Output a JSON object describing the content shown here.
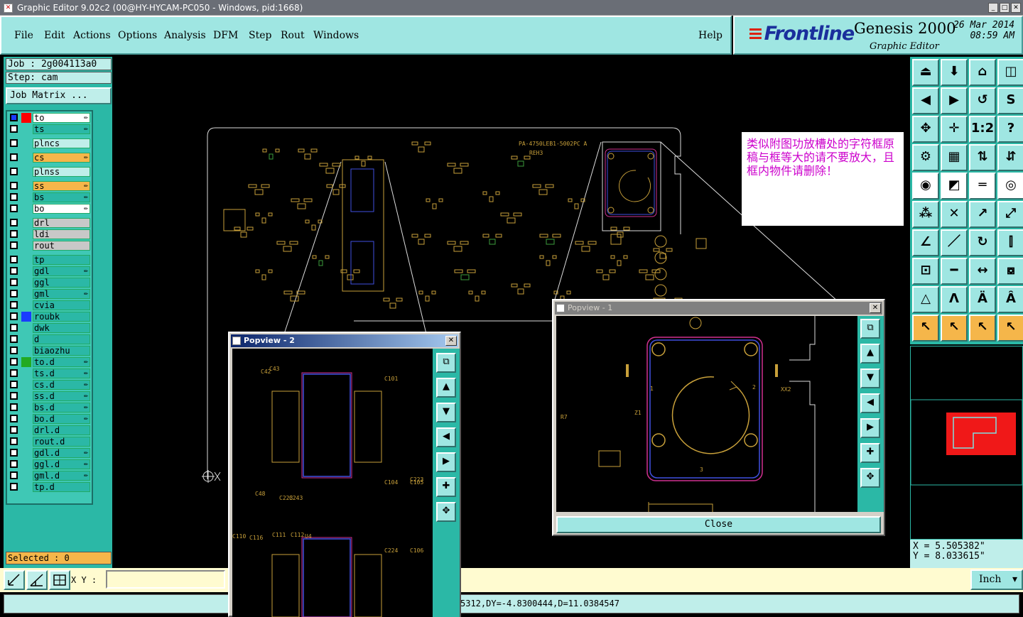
{
  "window": {
    "title": "Graphic Editor 9.02c2 (00@HY-HYCAM-PC050 - Windows, pid:1668)",
    "min": "_",
    "max": "□",
    "close": "✕"
  },
  "menu": [
    "File",
    "Edit",
    "Actions",
    "Options",
    "Analysis",
    "DFM",
    "Step",
    "Rout",
    "Windows"
  ],
  "help": "Help",
  "brand": {
    "logo": "Frontline",
    "product": "Genesis 2000",
    "subtitle": "Graphic Editor",
    "date": "26 Mar 2014",
    "time": "08:59 AM"
  },
  "job": {
    "job_line": "Job : 2g004113a0",
    "step_line": "Step: cam",
    "matrix_button": "Job Matrix ..."
  },
  "layers": [
    {
      "name": "to",
      "color": "#ff0000",
      "name_bg": "#ffffff",
      "mark": "✏",
      "checked": true
    },
    {
      "name": "ts",
      "color": "",
      "name_bg": "#2bb8a6",
      "mark": "✏"
    },
    {
      "name": "plncs",
      "color": "",
      "name_bg": "#bfeeea",
      "mark": ""
    },
    {
      "name": "cs",
      "color": "",
      "name_bg": "#f5b64a",
      "mark": "✏"
    },
    {
      "name": "plnss",
      "color": "",
      "name_bg": "#bfeeea",
      "mark": ""
    },
    {
      "name": "ss",
      "color": "",
      "name_bg": "#f5b64a",
      "mark": "✏"
    },
    {
      "name": "bs",
      "color": "",
      "name_bg": "#2bb8a6",
      "mark": "✏"
    },
    {
      "name": "bo",
      "color": "",
      "name_bg": "#ffffff",
      "mark": "✏"
    },
    {
      "name": "drl",
      "color": "",
      "name_bg": "#c8c8c8",
      "mark": ""
    },
    {
      "name": "ldi",
      "color": "",
      "name_bg": "#c8c8c8",
      "mark": ""
    },
    {
      "name": "rout",
      "color": "",
      "name_bg": "#c8c8c8",
      "mark": ""
    },
    {
      "name": "tp",
      "color": "",
      "name_bg": "#2bb8a6",
      "mark": ""
    },
    {
      "name": "gdl",
      "color": "",
      "name_bg": "#2bb8a6",
      "mark": "✏"
    },
    {
      "name": "ggl",
      "color": "",
      "name_bg": "#2bb8a6",
      "mark": ""
    },
    {
      "name": "gml",
      "color": "",
      "name_bg": "#2bb8a6",
      "mark": "✏"
    },
    {
      "name": "cvia",
      "color": "",
      "name_bg": "#2bb8a6",
      "mark": ""
    },
    {
      "name": "roubk",
      "color": "#1a3cff",
      "name_bg": "#2bb8a6",
      "mark": ""
    },
    {
      "name": "dwk",
      "color": "",
      "name_bg": "#2bb8a6",
      "mark": ""
    },
    {
      "name": "d",
      "color": "",
      "name_bg": "#2bb8a6",
      "mark": ""
    },
    {
      "name": "biaozhu",
      "color": "",
      "name_bg": "#2bb8a6",
      "mark": ""
    },
    {
      "name": "to.d",
      "color": "#22aa22",
      "name_bg": "#2bb8a6",
      "mark": "✏"
    },
    {
      "name": "ts.d",
      "color": "",
      "name_bg": "#2bb8a6",
      "mark": "✏"
    },
    {
      "name": "cs.d",
      "color": "",
      "name_bg": "#2bb8a6",
      "mark": "✏"
    },
    {
      "name": "ss.d",
      "color": "",
      "name_bg": "#2bb8a6",
      "mark": "✏"
    },
    {
      "name": "bs.d",
      "color": "",
      "name_bg": "#2bb8a6",
      "mark": "✏"
    },
    {
      "name": "bo.d",
      "color": "",
      "name_bg": "#2bb8a6",
      "mark": "✏"
    },
    {
      "name": "drl.d",
      "color": "",
      "name_bg": "#2bb8a6",
      "mark": ""
    },
    {
      "name": "rout.d",
      "color": "",
      "name_bg": "#2bb8a6",
      "mark": ""
    },
    {
      "name": "gdl.d",
      "color": "",
      "name_bg": "#2bb8a6",
      "mark": "✏"
    },
    {
      "name": "ggl.d",
      "color": "",
      "name_bg": "#2bb8a6",
      "mark": "✏"
    },
    {
      "name": "gml.d",
      "color": "",
      "name_bg": "#2bb8a6",
      "mark": "✏"
    },
    {
      "name": "tp.d",
      "color": "",
      "name_bg": "#2bb8a6",
      "mark": ""
    }
  ],
  "selected": "Selected : 0",
  "xy_label": "X Y :",
  "xy_value": "",
  "unit": "Inch",
  "status_text": "5312,DY=-4.8300444,D=11.0384547",
  "coords": {
    "x": "X  =  5.505382\"",
    "y": "Y  =  8.033615\""
  },
  "note": "类似附图功放槽处的字符框原稿与框等大的请不要放大，且框内物件请删除！",
  "board_labels": {
    "part": "PA-4750LEB1-5002PC A",
    "rev": "REH3"
  },
  "popview1": {
    "title": "Popview - 1",
    "close_label": "Close",
    "refdes": [
      "1",
      "2",
      "3",
      "Z1",
      "R7",
      "XX2"
    ]
  },
  "popview2": {
    "title": "Popview - 2",
    "refdes": [
      "C42",
      "C43",
      "C101",
      "C48",
      "C223",
      "C243",
      "C104",
      "C105",
      "C110",
      "C116",
      "C111",
      "C112",
      "U4",
      "C224",
      "C106",
      "C223"
    ]
  },
  "colors": {
    "accent": "#2bb8a6",
    "panel": "#9fe6e2",
    "copper": "#c8a03a",
    "selected": "#f5b64a",
    "note_text": "#cc00cc"
  }
}
